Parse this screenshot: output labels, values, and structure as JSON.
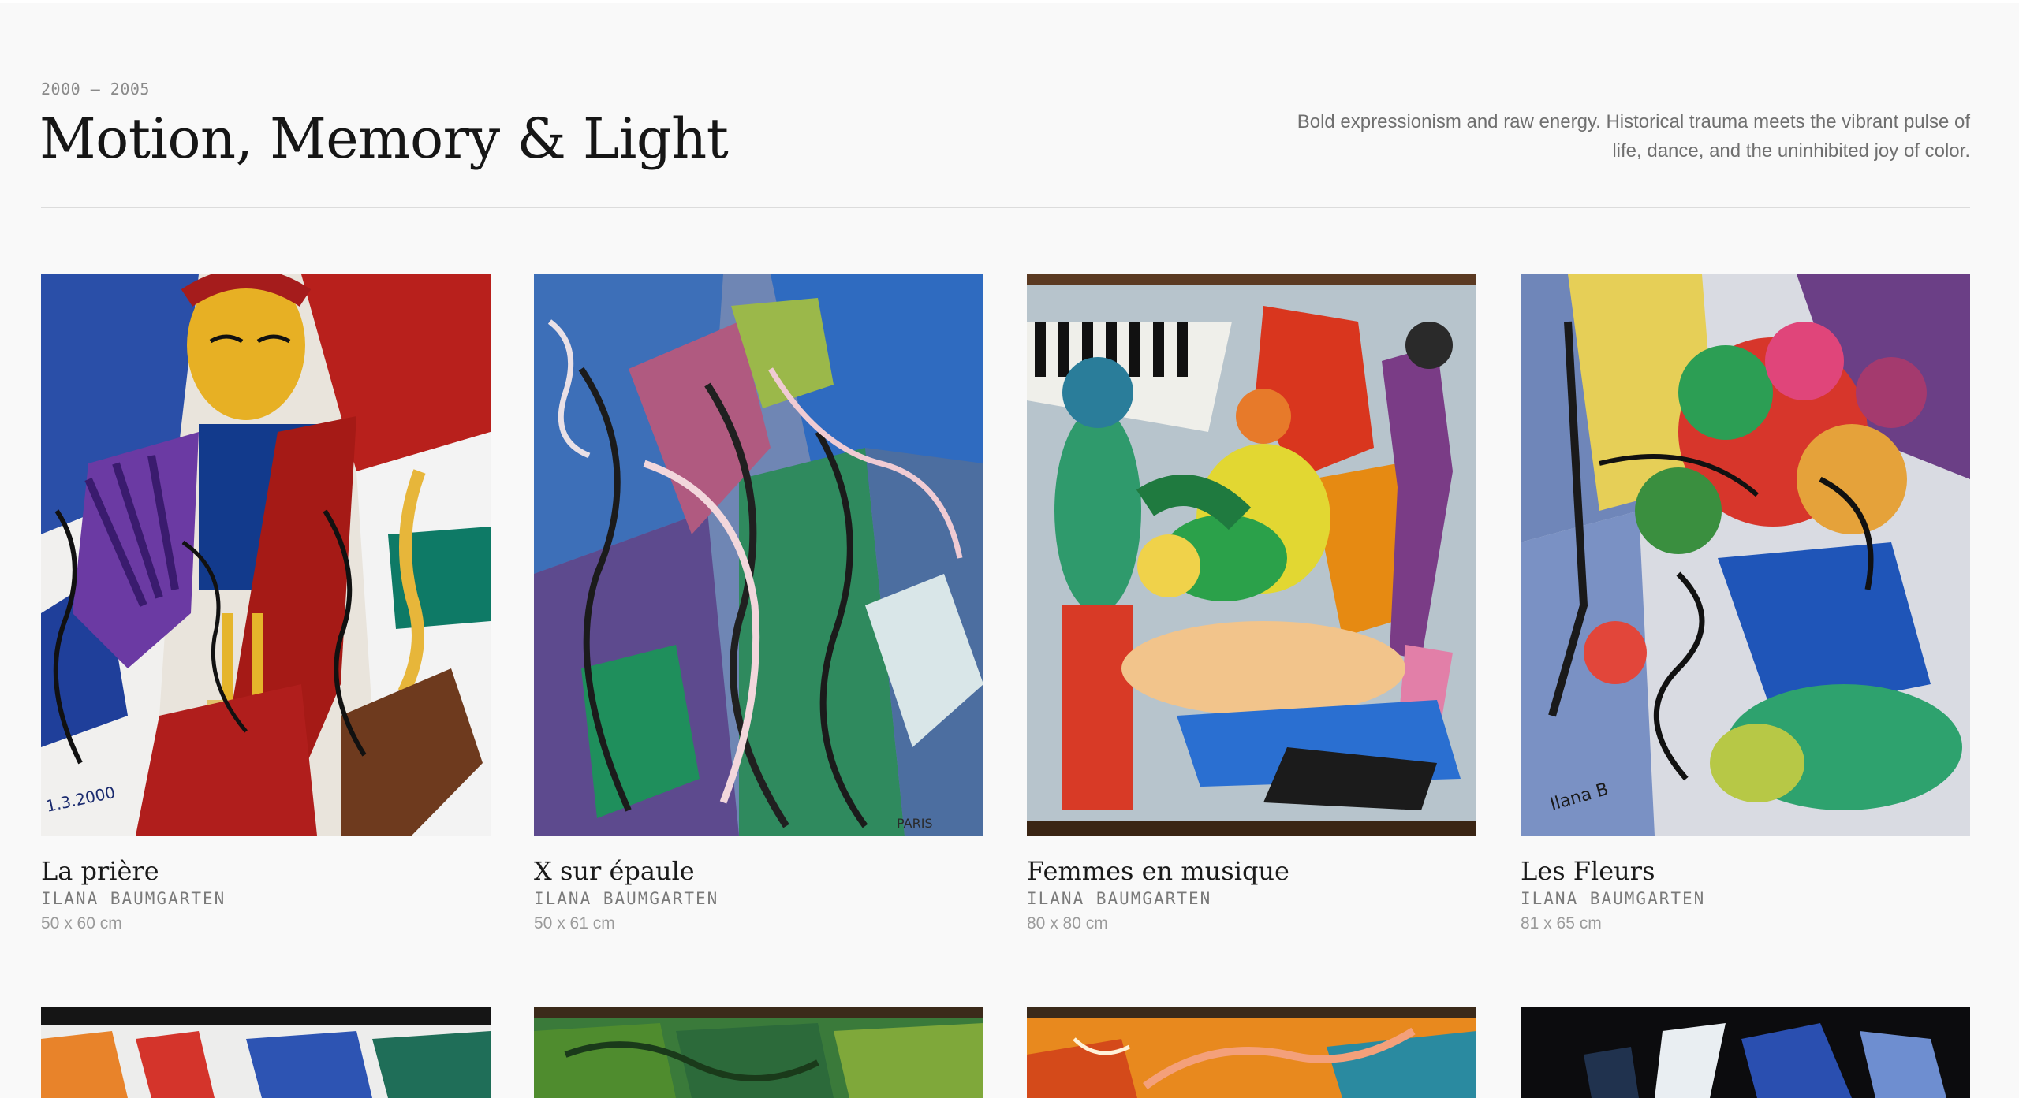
{
  "section": {
    "years": "2000 — 2005",
    "title": "Motion, Memory & Light",
    "description": "Bold expressionism and raw energy. Historical trauma meets the vibrant pulse of life, dance, and the uninhibited joy of color."
  },
  "artworks": [
    {
      "title": "La prière",
      "artist": "ILANA BAUMGARTEN",
      "size": "50 x 60 cm"
    },
    {
      "title": "X sur épaule",
      "artist": "ILANA BAUMGARTEN",
      "size": "50 x 61 cm"
    },
    {
      "title": "Femmes en musique",
      "artist": "ILANA BAUMGARTEN",
      "size": "80 x 80 cm"
    },
    {
      "title": "Les Fleurs",
      "artist": "ILANA BAUMGARTEN",
      "size": "81 x 65 cm"
    }
  ]
}
